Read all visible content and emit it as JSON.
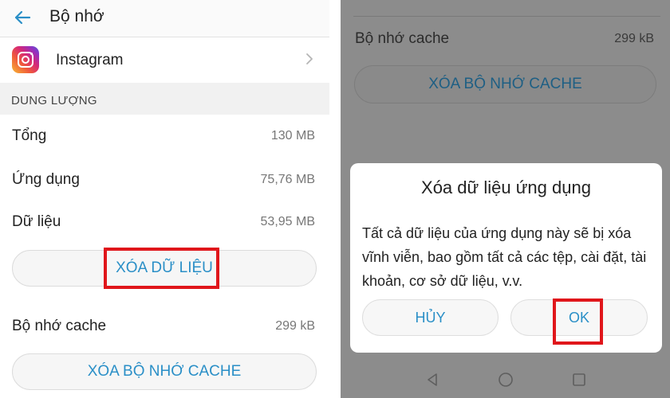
{
  "left": {
    "header": {
      "title": "Bộ nhớ",
      "back_icon": "arrow-left-icon"
    },
    "app": {
      "name": "Instagram",
      "icon": "instagram-icon",
      "chevron_icon": "chevron-right-icon"
    },
    "section": {
      "title": "DUNG LƯỢNG"
    },
    "rows": [
      {
        "label": "Tổng",
        "value": "130 MB"
      },
      {
        "label": "Ứng dụng",
        "value": "75,76 MB"
      },
      {
        "label": "Dữ liệu",
        "value": "53,95 MB"
      }
    ],
    "clear_data_label": "XÓA DỮ LIỆU",
    "cache": {
      "label": "Bộ nhớ cache",
      "value": "299 kB"
    },
    "clear_cache_label": "XÓA BỘ NHỚ CACHE"
  },
  "right": {
    "cache": {
      "label": "Bộ nhớ cache",
      "value": "299 kB"
    },
    "clear_cache_label": "XÓA BỘ NHỚ CACHE",
    "dialog": {
      "title": "Xóa dữ liệu ứng dụng",
      "message": "Tất cả dữ liệu của ứng dụng này sẽ bị xóa vĩnh viễn, bao gồm tất cả các tệp, cài đặt, tài khoản, cơ sở dữ liệu, v.v.",
      "cancel_label": "HỦY",
      "ok_label": "OK"
    },
    "navbar": {
      "back_icon": "nav-back-triangle-icon",
      "home_icon": "nav-home-circle-icon",
      "recent_icon": "nav-recent-square-icon"
    }
  },
  "colors": {
    "accent": "#2a8fc7",
    "highlight": "#e0161b",
    "overlay": "#8c8c8c",
    "section_bg": "#f1f1f1"
  }
}
